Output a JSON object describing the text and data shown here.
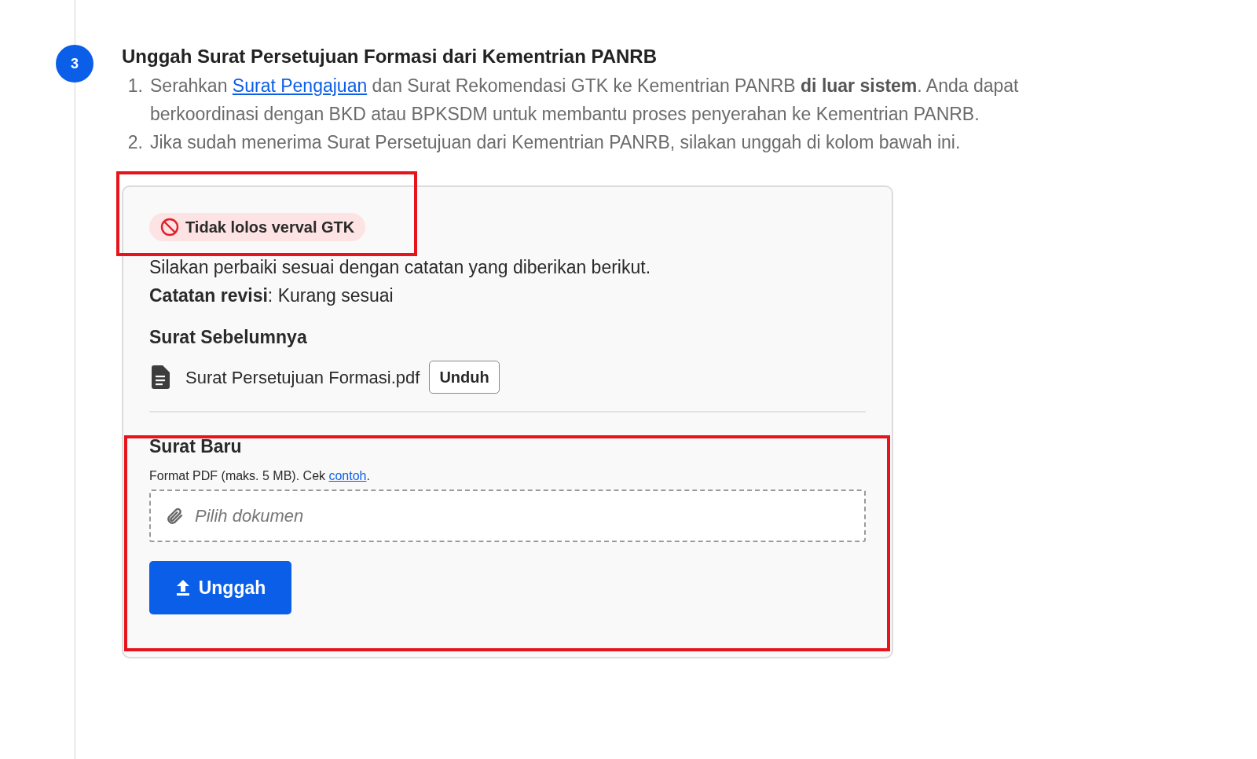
{
  "step": {
    "number": "3",
    "title": "Unggah Surat Persetujuan Formasi dari Kementrian PANRB"
  },
  "instructions": [
    {
      "number": "1.",
      "before": "Serahkan ",
      "link": "Surat Pengajuan",
      "after": " dan Surat Rekomendasi GTK ke Kementrian PANRB **di luar sistem**. Anda dapat berkoordinasi dengan BKD atau BPKSDM untuk membantu proses penyerahan ke Kementrian PANRB."
    },
    {
      "number": "2.",
      "before": "Jika sudah menerima Surat Persetujuan dari Kementrian PANRB, silakan unggah di kolom bawah ini."
    }
  ],
  "card": {
    "status_badge": "Tidak lolos verval GTK",
    "message": "Silakan perbaiki sesuai dengan catatan yang diberikan berikut.",
    "note": "**Catatan revisi**: Kurang sesuai",
    "previous_heading": "Surat Sebelumnya",
    "previous_file": "Surat Persetujuan Formasi.pdf",
    "download_button": "Unduh",
    "new_heading": "Surat Baru",
    "format_hint": "Format PDF (maks. 5 MB). Cek ",
    "example_link": "contoh",
    "hint_end": ".",
    "file_field": {
      "placeholder": "Pilih dokumen"
    },
    "upload_button": "Unggah"
  }
}
